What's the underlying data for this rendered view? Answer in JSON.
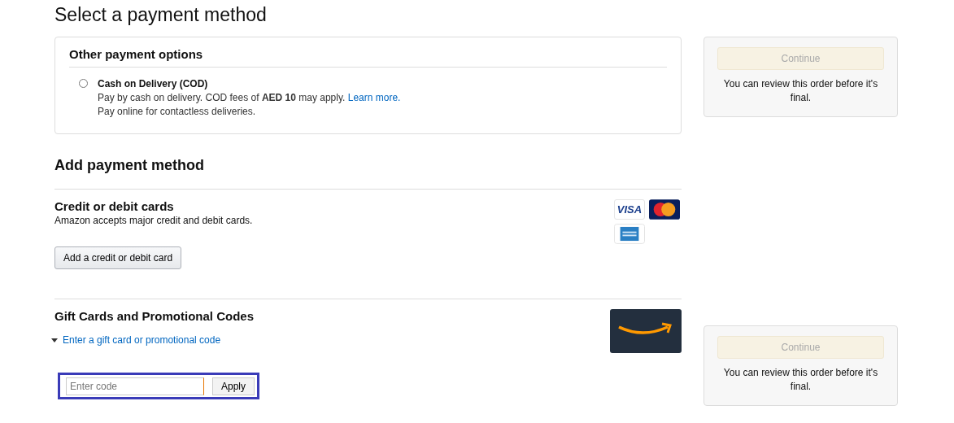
{
  "title": "Select a payment method",
  "other_options": {
    "heading": "Other payment options",
    "options": [
      {
        "label": "Cash on Delivery (COD)",
        "description": "Pay by cash on delivery. COD fees of **AED 10** may apply.",
        "link": "Learn more.",
        "note": "Pay online for contactless deliveries.",
        "selected": false
      }
    ]
  },
  "add_heading": "Add payment method",
  "cards": {
    "heading": "Credit or debit cards",
    "description": "Amazon accepts major credit and debit cards.",
    "button": "Add a credit or debit card",
    "logos": [
      {
        "kind": "visa",
        "text": "VISA"
      },
      {
        "kind": "mastercard"
      },
      {
        "kind": "amex"
      }
    ]
  },
  "gift": {
    "heading": "Gift Cards and Promotional Codes",
    "toggle": "Enter a gift card or promotional code",
    "expanded": true,
    "placeholder": "Enter code",
    "button": "Apply"
  },
  "side_boxes": [
    {
      "button": "Continue",
      "disabled": true,
      "note": "You can review this order before it's final."
    },
    {
      "button": "Continue",
      "disabled": true,
      "note": "You can review this order before it's final."
    }
  ]
}
